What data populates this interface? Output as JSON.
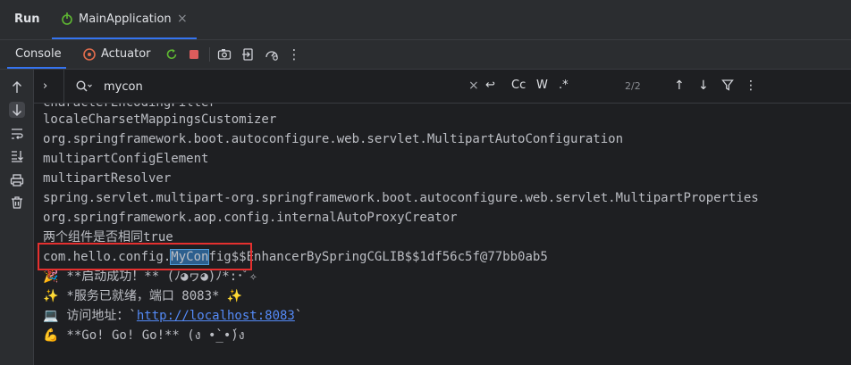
{
  "topbar": {
    "run_label": "Run",
    "tab": {
      "label": "MainApplication",
      "close_glyph": "×",
      "icon": "spring-icon"
    }
  },
  "toolbar": {
    "console_label": "Console",
    "actuator_label": "Actuator",
    "icons": [
      "rerun-icon",
      "stop-icon",
      "camera-icon",
      "exit-icon",
      "gauge-icon",
      "more-icon"
    ],
    "more_glyph": "⋮"
  },
  "gutter": {
    "icons": [
      "scroll-up-icon",
      "scroll-down-icon",
      "soft-wrap-icon",
      "scroll-to-end-icon",
      "print-icon",
      "trash-icon"
    ]
  },
  "search": {
    "expand_glyph": "›",
    "value": "mycon",
    "clear_glyph": "×",
    "regex_prev_glyph": "↩",
    "match_case": "Cc",
    "words": "W",
    "regex": ".*",
    "count": "2/2",
    "prev_glyph": "↑",
    "next_glyph": "↓",
    "filter_glyph": "⏷",
    "more_glyph": "⋮"
  },
  "console": {
    "lines": [
      "characterEncodingFilter",
      "localeCharsetMappingsCustomizer",
      "org.springframework.boot.autoconfigure.web.servlet.MultipartAutoConfiguration",
      "multipartConfigElement",
      "multipartResolver",
      "spring.servlet.multipart-org.springframework.boot.autoconfigure.web.servlet.MultipartProperties",
      "org.springframework.aop.config.internalAutoProxyCreator",
      "两个组件是否相同true"
    ],
    "highlight_line": {
      "before": "com.hello.config.",
      "match": "MyCon",
      "after": "fig$$EnhancerBySpringCGLIB$$1df56c5f@77bb0ab5"
    },
    "emoji_lines": [
      {
        "emoji": "🎉",
        "text": " **启动成功！** (ﾉ◕ヮ◕)ﾉ*:･ﾟ✧"
      },
      {
        "emoji": "✨",
        "text": " *服务已就绪，端口 8083* ✨"
      },
      {
        "emoji": "💻",
        "text": " 访问地址：`",
        "link": "http://localhost:8083",
        "after": "`"
      },
      {
        "emoji": "💪",
        "text": " **Go! Go! Go!** (ง •̀_•́)ง"
      }
    ]
  },
  "colors": {
    "accent": "#3574f0",
    "highlight_box": "#e5302f",
    "match_bg": "#2d5f8e",
    "link": "#548af7"
  }
}
